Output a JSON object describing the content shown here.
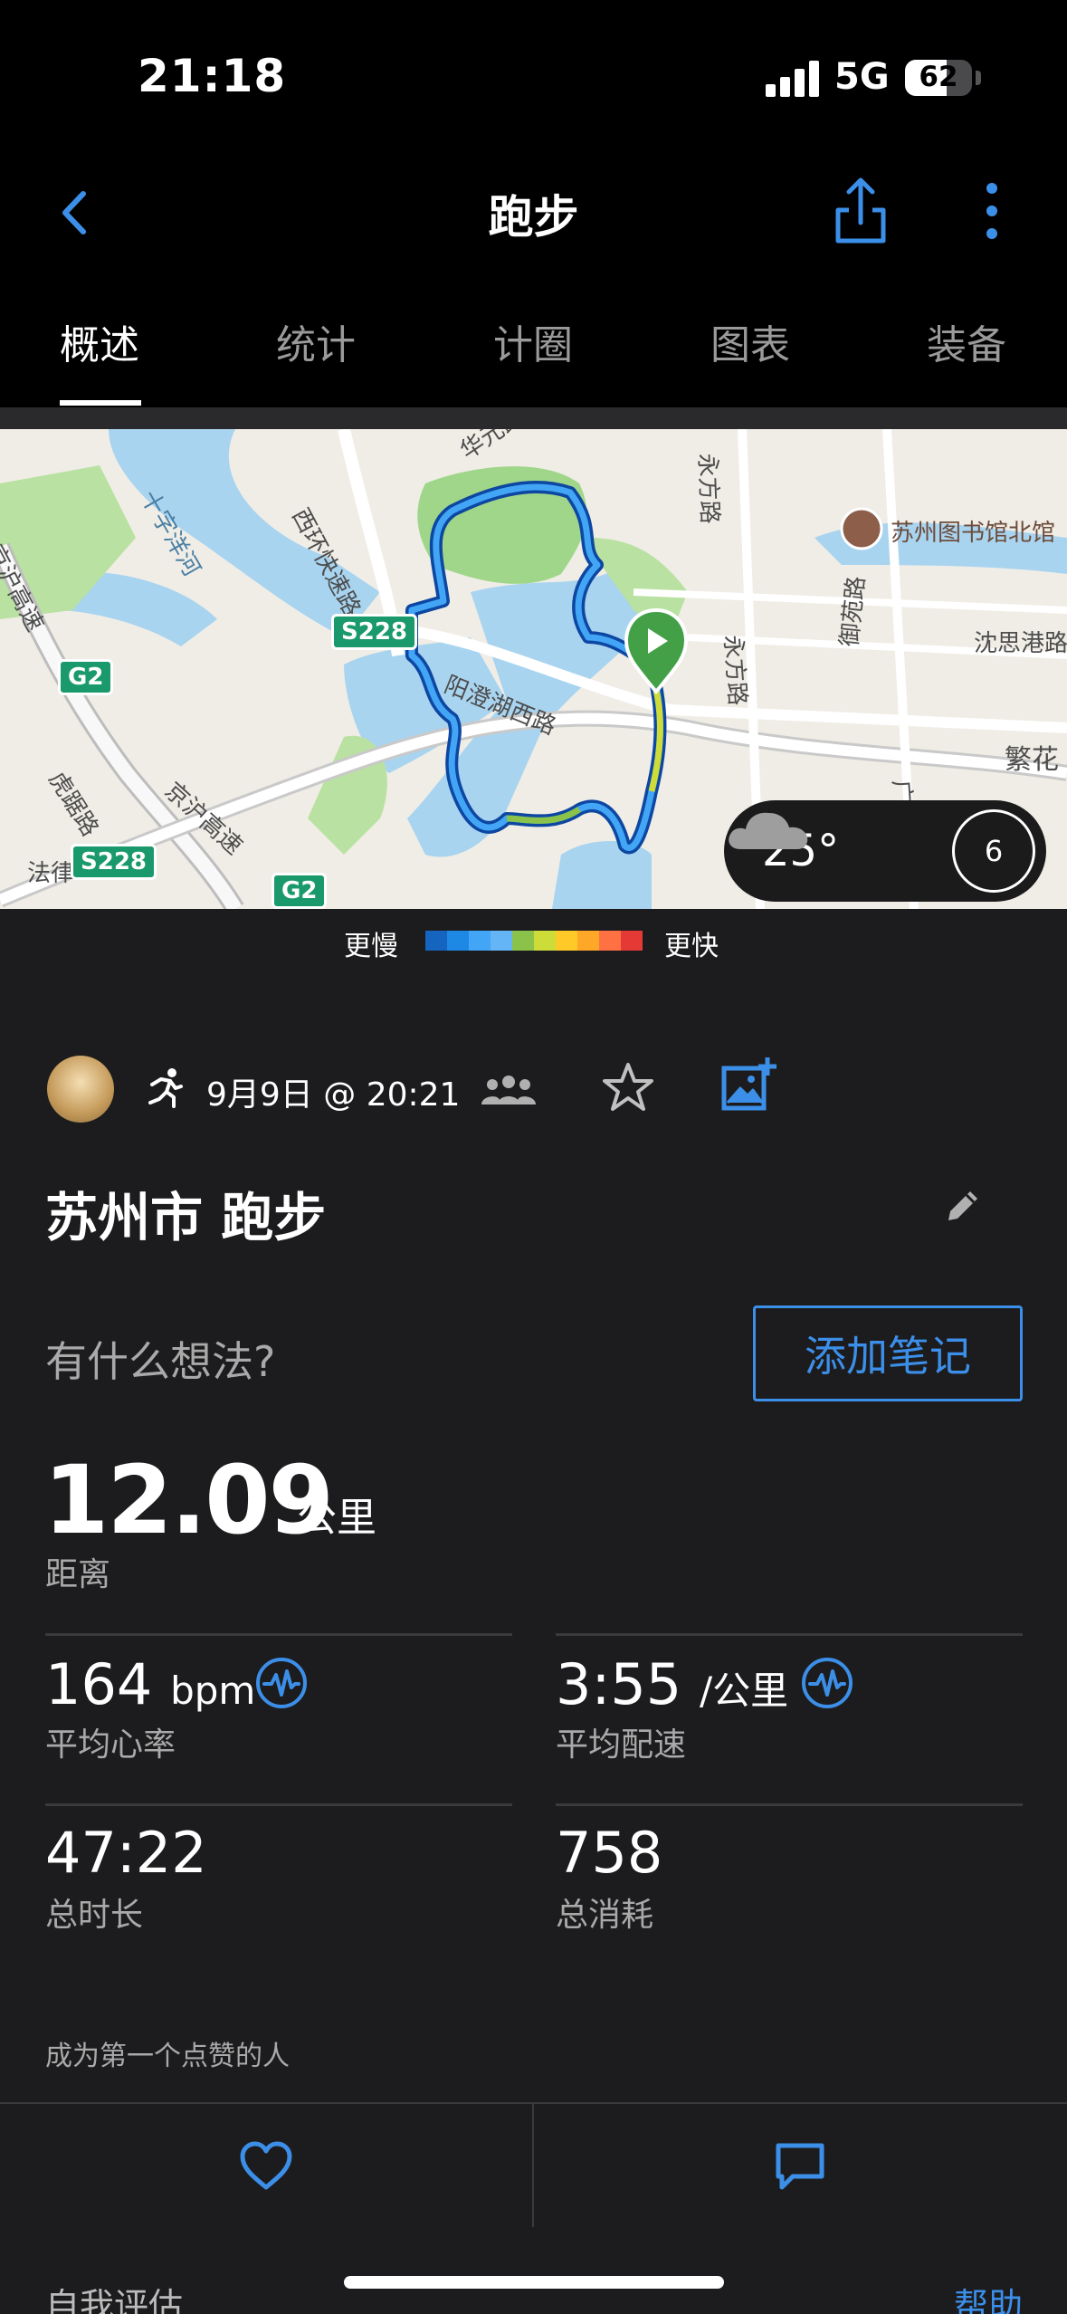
{
  "status_bar": {
    "time": "21:18",
    "network": "5G",
    "battery": "62",
    "battery_level": 0.62
  },
  "nav": {
    "title": "跑步"
  },
  "tabs": [
    {
      "label": "概述",
      "active": true
    },
    {
      "label": "统计",
      "active": false
    },
    {
      "label": "计圈",
      "active": false
    },
    {
      "label": "图表",
      "active": false
    },
    {
      "label": "装备",
      "active": false
    }
  ],
  "map": {
    "labels": [
      "西环快速路",
      "十字洋河",
      "京沪高速",
      "虎踞路",
      "京沪高速",
      "阳澄湖西路",
      "永方路",
      "永方路",
      "御苑路",
      "苏州图书馆北馆",
      "沈思港路",
      "繁花",
      "广济",
      "法律",
      "华元路"
    ],
    "badges": [
      "S228",
      "G2",
      "S228",
      "G2"
    ],
    "weather": {
      "temperature": "25°",
      "wind": "6"
    }
  },
  "pace_legend": {
    "slow_label": "更慢",
    "fast_label": "更快",
    "colors": [
      "#1565c0",
      "#1e88e5",
      "#42a5f5",
      "#64b5f6",
      "#8bc34a",
      "#cddc39",
      "#ffca28",
      "#ffa726",
      "#ff7043",
      "#e53935"
    ]
  },
  "activity": {
    "datetime": "9月9日 @ 20:21",
    "title": "苏州市 跑步",
    "prompt": "有什么想法?",
    "add_note_label": "添加笔记"
  },
  "stats": {
    "distance": {
      "value": "12.09",
      "unit": "公里",
      "label": "距离"
    },
    "heart_rate": {
      "value": "164",
      "unit": "bpm",
      "label": "平均心率"
    },
    "pace": {
      "value": "3:55",
      "unit": "/公里",
      "label": "平均配速"
    },
    "duration": {
      "value": "47:22",
      "label": "总时长"
    },
    "calories": {
      "value": "758",
      "label": "总消耗"
    }
  },
  "social": {
    "like_prompt": "成为第一个点赞的人"
  },
  "footer": {
    "self_eval": "自我评估",
    "help": "帮助"
  },
  "colors": {
    "accent": "#3c8fe8",
    "background": "#1c1c1e",
    "route_start": "#43a047"
  }
}
